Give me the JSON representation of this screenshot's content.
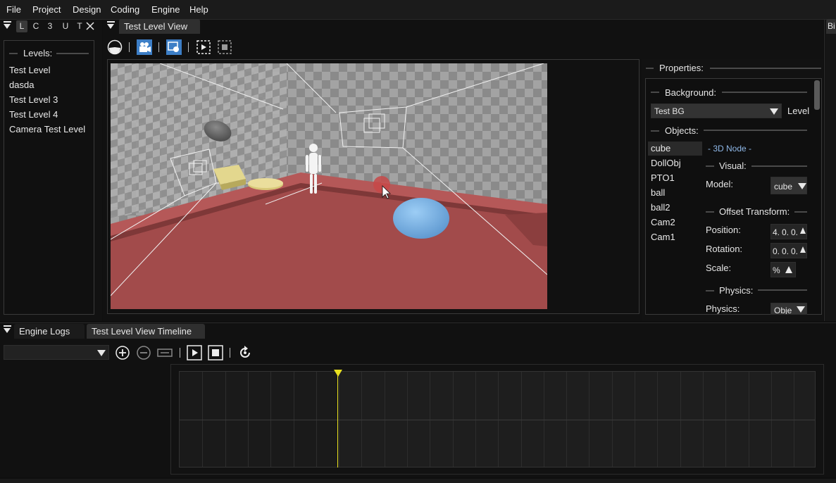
{
  "menu": [
    "File",
    "Project",
    "Design",
    "Coding",
    "Engine",
    "Help"
  ],
  "left_panel": {
    "minitabs": [
      "L",
      "C",
      "3",
      "U",
      "T"
    ],
    "levels_header": "Levels:",
    "levels": [
      "Test Level",
      "dasda",
      "Test Level 3",
      "Test Level 4",
      "Camera Test Level"
    ]
  },
  "center": {
    "tab": "Test Level View"
  },
  "right_edge_tab": "Bi",
  "properties": {
    "header": "Properties:",
    "background_header": "Background:",
    "background_value": "Test BG",
    "background_suffix": "Level",
    "objects_header": "Objects:",
    "objects": [
      "cube",
      "DollObj",
      "PTO1",
      "ball",
      "ball2",
      "Cam2",
      "Cam1"
    ],
    "selected_object": "cube",
    "node_type": "- 3D Node -",
    "visual_header": "Visual:",
    "model_label": "Model:",
    "model_value": "cube",
    "offset_header": "Offset Transform:",
    "position_label": "Position:",
    "position_values": [
      "4.",
      "0.",
      "0."
    ],
    "rotation_label": "Rotation:",
    "rotation_values": [
      "0.",
      "0.",
      "0."
    ],
    "scale_label": "Scale:",
    "scale_value": "%",
    "physics_header": "Physics:",
    "physics_label": "Physics:",
    "physics_value": "Obje"
  },
  "bottom": {
    "tabs": [
      "Engine Logs",
      "Test Level View Timeline"
    ],
    "dropdown_value": ""
  },
  "colors": {
    "floor": "#a04a4a",
    "ball": "#79b5ea",
    "cube": "#d8c878",
    "playhead": "#e8e020",
    "link": "#8fb8e8"
  }
}
